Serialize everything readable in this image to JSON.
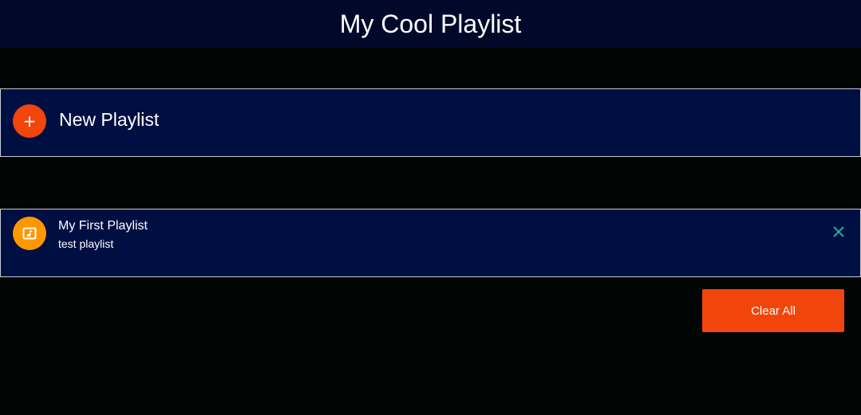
{
  "header": {
    "title": "My Cool Playlist"
  },
  "new_playlist": {
    "icon": "plus-icon",
    "icon_glyph": "+",
    "label": "New Playlist"
  },
  "playlists": [
    {
      "icon": "music-note-icon",
      "title": "My First Playlist",
      "subtitle": "test playlist",
      "remove_icon": "close-icon"
    }
  ],
  "actions": {
    "clear_all_label": "Clear All"
  },
  "colors": {
    "background": "#010604",
    "header": "#000929",
    "card": "#000f42",
    "accent": "#f1450b",
    "playlist_icon": "#ff9800",
    "close": "#26a69a"
  }
}
